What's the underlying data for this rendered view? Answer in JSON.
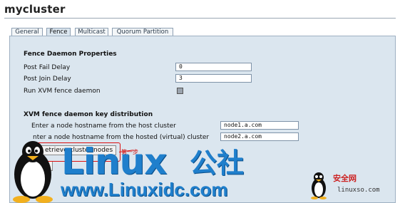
{
  "page": {
    "title": "mycluster"
  },
  "tabs": [
    {
      "label": "General",
      "active": false
    },
    {
      "label": "Fence",
      "active": true
    },
    {
      "label": "Multicast",
      "active": false
    },
    {
      "label": "Quorum Partition",
      "active": false
    }
  ],
  "fence_daemon": {
    "heading": "Fence Daemon Properties",
    "post_fail_delay": {
      "label": "Post Fail Delay",
      "value": "0"
    },
    "post_join_delay": {
      "label": "Post Join Delay",
      "value": "3"
    },
    "run_xvm": {
      "label": "Run XVM fence daemon",
      "checked": true
    }
  },
  "xvm_key": {
    "heading": "XVM fence daemon key distribution",
    "host_label": "Enter a node hostname from the host cluster",
    "host_value": "node1.a.com",
    "hosted_label": "nter a node hostname from the hosted (virtual) cluster",
    "hosted_value": "node2.a.com",
    "retrieve_button": "etrieve cluster nodes"
  },
  "annotation": {
    "text": "第一步",
    "color": "#dd1111"
  },
  "watermark": {
    "logo_text": "Linux",
    "logo_cn": "公社",
    "site_url": "www.Linuxidc.com",
    "small_cn": "安全网",
    "small_url": "linuxso.com",
    "brand_color": "#1f7fcc"
  }
}
